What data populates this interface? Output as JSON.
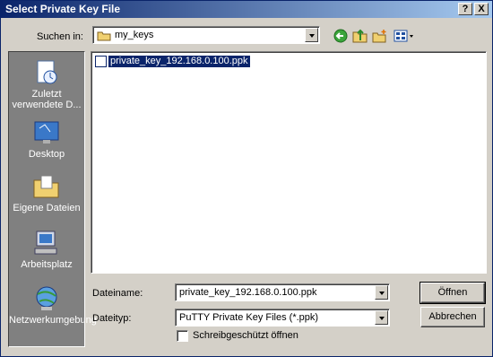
{
  "window": {
    "title": "Select Private Key File",
    "help_label": "?",
    "close_label": "X"
  },
  "toolbar": {
    "look_in_label": "Suchen in:",
    "look_in_value": "my_keys",
    "icons": [
      "back-icon",
      "up-folder-icon",
      "new-folder-icon",
      "view-menu-icon"
    ]
  },
  "places": [
    {
      "label": "Zuletzt verwendete D...",
      "icon": "recent-documents-icon"
    },
    {
      "label": "Desktop",
      "icon": "desktop-icon"
    },
    {
      "label": "Eigene Dateien",
      "icon": "my-documents-icon"
    },
    {
      "label": "Arbeitsplatz",
      "icon": "my-computer-icon"
    },
    {
      "label": "Netzwerkumgebung",
      "icon": "network-places-icon"
    }
  ],
  "files": [
    {
      "name": "private_key_192.168.0.100.ppk",
      "selected": true
    }
  ],
  "form": {
    "filename_label": "Dateiname:",
    "filename_value": "private_key_192.168.0.100.ppk",
    "filetype_label": "Dateityp:",
    "filetype_value": "PuTTY Private Key Files (*.ppk)",
    "readonly_label": "Schreibgeschützt öffnen",
    "readonly_checked": false
  },
  "buttons": {
    "open_label": "Öffnen",
    "cancel_label": "Abbrechen"
  },
  "colors": {
    "title_start": "#0a246a",
    "title_end": "#a6caf0",
    "face": "#d4d0c8",
    "places_bg": "#808080",
    "selection": "#0a246a"
  }
}
